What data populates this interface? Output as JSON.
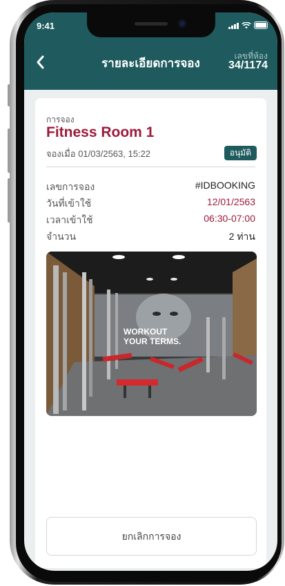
{
  "status_bar": {
    "time": "9:41"
  },
  "header": {
    "title": "รายละเอียดการจอง",
    "room_label": "เลขที่ห้อง",
    "room_number": "34/1174"
  },
  "booking": {
    "section_label": "การจอง",
    "name": "Fitness Room 1",
    "booked_at": "จองเมื่อ 01/03/2563, 15:22",
    "status": "อนุมัติ",
    "details": [
      {
        "label": "เลขการจอง",
        "value": "#IDBOOKING"
      },
      {
        "label": "วันที่เข้าใช้",
        "value": "12/01/2563"
      },
      {
        "label": "เวลาเข้าใช้",
        "value": "06:30-07:00"
      },
      {
        "label": "จำนวน",
        "value": "2 ท่าน"
      }
    ],
    "photo_poster_text": [
      "WORKOUT",
      "YOUR TERMS."
    ],
    "cancel_label": "ยกเลิกการจอง"
  },
  "colors": {
    "header_bg": "#1f5b5e",
    "accent_red": "#9c1b3a",
    "badge_bg": "#1f5b5e"
  }
}
